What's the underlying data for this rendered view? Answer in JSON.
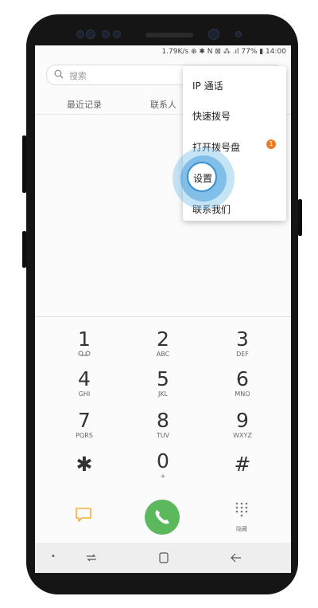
{
  "status_bar": {
    "text": "1.79K/s ⊕ ✱ N ⊠ ⁂ .ıl 77% ▮ 14:00"
  },
  "search": {
    "placeholder": "搜索"
  },
  "tabs": [
    {
      "label": "最近记录"
    },
    {
      "label": "联系人"
    }
  ],
  "menu": {
    "items": [
      {
        "label": "IP 通话"
      },
      {
        "label": "快速拨号"
      },
      {
        "label": "打开拨号盘",
        "badge": "1"
      },
      {
        "label": "设置"
      },
      {
        "label": "联系我们"
      }
    ]
  },
  "keypad": [
    {
      "digit": "1",
      "letters": ""
    },
    {
      "digit": "2",
      "letters": "ABC"
    },
    {
      "digit": "3",
      "letters": "DEF"
    },
    {
      "digit": "4",
      "letters": "GHI"
    },
    {
      "digit": "5",
      "letters": "JKL"
    },
    {
      "digit": "6",
      "letters": "MNO"
    },
    {
      "digit": "7",
      "letters": "PQRS"
    },
    {
      "digit": "8",
      "letters": "TUV"
    },
    {
      "digit": "9",
      "letters": "WXYZ"
    },
    {
      "digit": "✱",
      "letters": ""
    },
    {
      "digit": "0",
      "letters": "+"
    },
    {
      "digit": "#",
      "letters": ""
    }
  ],
  "bottom": {
    "hide_label": "隐藏"
  },
  "colors": {
    "accent": "#f07b22",
    "call": "#5cb85c",
    "highlight": "#3a8fd0",
    "message_icon": "#f2b134"
  },
  "icons": {
    "search": "search-icon",
    "voicemail": "voicemail-icon",
    "message": "message-icon",
    "call": "phone-icon",
    "dialpad": "dialpad-grid-icon",
    "recent_apps": "recent-apps-icon",
    "home": "home-icon",
    "back": "back-icon"
  }
}
